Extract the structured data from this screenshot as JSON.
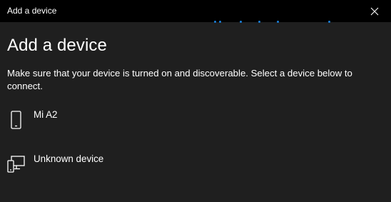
{
  "window": {
    "title": "Add a device",
    "close_icon": "close-icon"
  },
  "progress": {
    "accent_color": "#1a7fd8",
    "state": "searching"
  },
  "main": {
    "heading": "Add a device",
    "description": "Make sure that your device is turned on and discoverable. Select a device below to connect."
  },
  "devices": [
    {
      "name": "Mi A2",
      "icon": "phone-icon"
    },
    {
      "name": "Unknown device",
      "icon": "unknown-device-icon"
    }
  ],
  "theme": {
    "background": "#1f1f1f",
    "titlebar": "#000000",
    "text": "#ffffff"
  }
}
